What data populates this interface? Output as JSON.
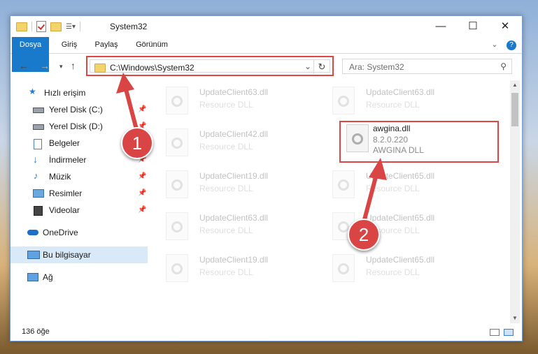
{
  "window": {
    "title": "System32",
    "minimize": "—",
    "maximize": "☐",
    "close": "✕"
  },
  "ribbon": {
    "tabs": [
      "Dosya",
      "Giriş",
      "Paylaş",
      "Görünüm"
    ],
    "help": "?",
    "collapse": "⌄"
  },
  "address": {
    "path": "C:\\Windows\\System32",
    "search_placeholder": "Ara: System32"
  },
  "sidebar": {
    "quick_access": "Hızlı erişim",
    "items": [
      {
        "label": "Yerel Disk (C:)",
        "icon": "drive-icon"
      },
      {
        "label": "Yerel Disk (D:)",
        "icon": "drive-icon"
      },
      {
        "label": "Belgeler",
        "icon": "documents-icon"
      },
      {
        "label": "İndirmeler",
        "icon": "downloads-icon"
      },
      {
        "label": "Müzik",
        "icon": "music-icon"
      },
      {
        "label": "Resimler",
        "icon": "pictures-icon"
      },
      {
        "label": "Videolar",
        "icon": "videos-icon"
      }
    ],
    "onedrive": "OneDrive",
    "this_pc": "Bu bilgisayar",
    "network": "Ağ"
  },
  "files": {
    "left": [
      "UpdateClient63.dll",
      "UpdateClient42.dll",
      "UpdateClient19.dll",
      "UpdateClient63.dll",
      "UpdateClient19.dll"
    ],
    "right": [
      "UpdateClient63.dll",
      "UpdateClient65.dll",
      "UpdateClient65.dll",
      "UpdateClient65.dll"
    ],
    "type": "Resource DLL",
    "selected": {
      "name": "awgina.dll",
      "version": "8.2.0.220",
      "description": "AWGINA  DLL"
    }
  },
  "status": {
    "count": "136 öğe"
  },
  "callouts": [
    "1",
    "2"
  ],
  "colors": {
    "accent": "#1979ca",
    "highlight": "#e04545",
    "selected_nav": "#d9e9f8"
  }
}
